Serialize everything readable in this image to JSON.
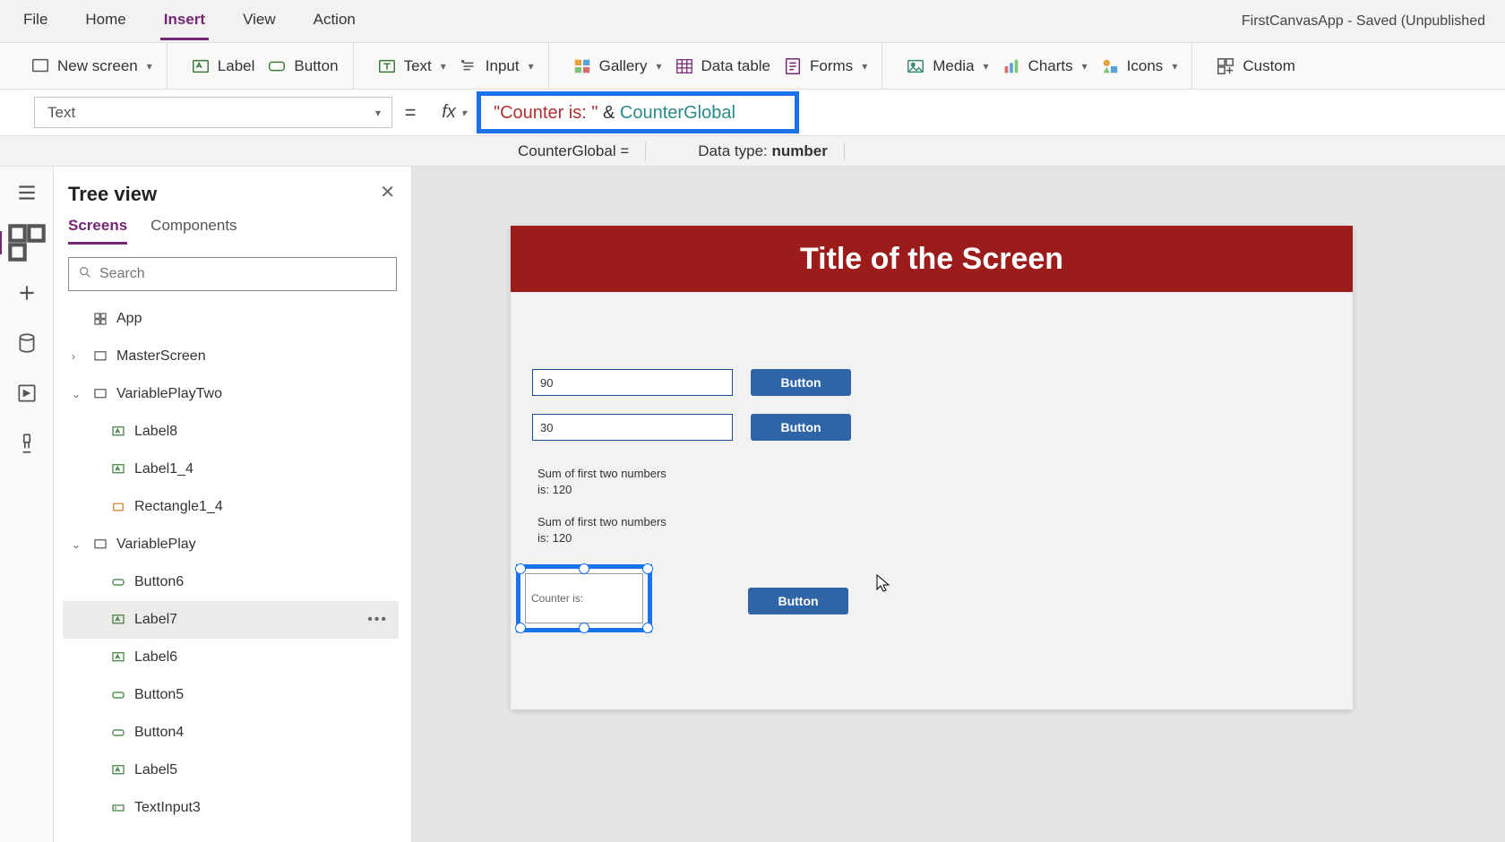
{
  "app_title": "FirstCanvasApp - Saved (Unpublished",
  "menubar": [
    "File",
    "Home",
    "Insert",
    "View",
    "Action"
  ],
  "menubar_active": "Insert",
  "ribbon": {
    "new_screen": "New screen",
    "label": "Label",
    "button": "Button",
    "text": "Text",
    "input": "Input",
    "gallery": "Gallery",
    "data_table": "Data table",
    "forms": "Forms",
    "media": "Media",
    "charts": "Charts",
    "icons": "Icons",
    "custom": "Custom"
  },
  "property_dropdown": "Text",
  "formula": {
    "string_part": "\"Counter is: \"",
    "op": " & ",
    "var_part": "CounterGlobal"
  },
  "info": {
    "var_eq": "CounterGlobal  =",
    "dtype_label": "Data type: ",
    "dtype_value": "number"
  },
  "treeview": {
    "title": "Tree view",
    "tabs": [
      "Screens",
      "Components"
    ],
    "active_tab": "Screens",
    "search_placeholder": "Search",
    "nodes": {
      "app": "App",
      "master": "MasterScreen",
      "vp2": "VariablePlayTwo",
      "l8": "Label8",
      "l1_4": "Label1_4",
      "r1_4": "Rectangle1_4",
      "vp": "VariablePlay",
      "b6": "Button6",
      "l7": "Label7",
      "l6": "Label6",
      "b5": "Button5",
      "b4": "Button4",
      "l5": "Label5",
      "ti3": "TextInput3"
    }
  },
  "canvas": {
    "title": "Title of the Screen",
    "input1": "90",
    "input2": "30",
    "btn": "Button",
    "sum1": "Sum of first two numbers is: 120",
    "sum2": "Sum of first two numbers is: 120",
    "sel_label": "Counter is:"
  }
}
